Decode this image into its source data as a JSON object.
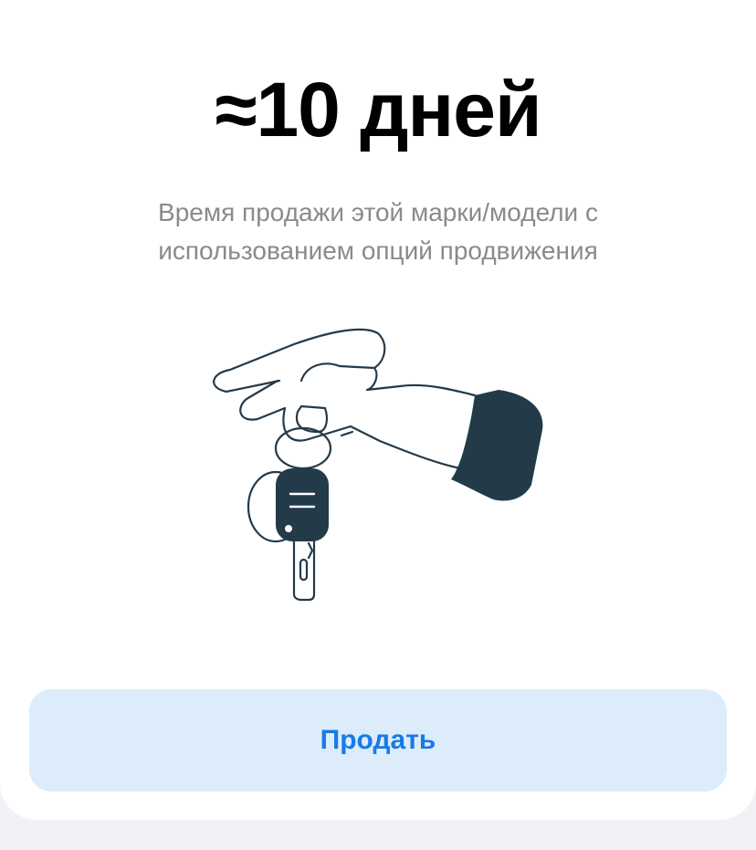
{
  "card": {
    "headline": "≈10 дней",
    "subtitle": "Время продажи этой марки/модели с использованием опций продвижения"
  },
  "illustration": {
    "icon": "hand-with-car-key-icon",
    "colors": {
      "stroke": "#243a4a",
      "fill_dark": "#233a49",
      "background": "#ffffff"
    }
  },
  "action": {
    "sell_label": "Продать",
    "colors": {
      "background": "#dcecfa",
      "text": "#1a7ae6"
    }
  }
}
